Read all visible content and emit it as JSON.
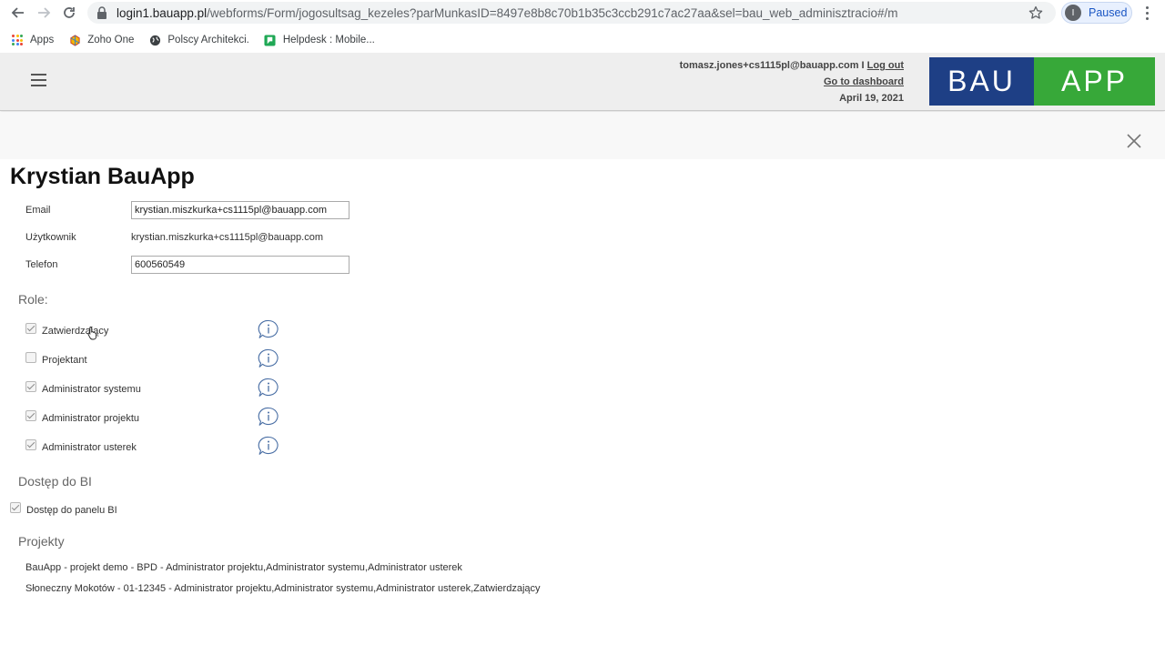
{
  "browser": {
    "url_host": "login1.bauapp.pl",
    "url_path": "/webforms/Form/jogosultsag_kezeles?parMunkasID=8497e8b8c70b1b35c3ccb291c7ac27aa&sel=bau_web_adminisztracio#/m",
    "profile_initial": "I",
    "profile_status": "Paused",
    "bookmarks": [
      "Apps",
      "Zoho One",
      "Polscy Architekci.",
      "Helpdesk : Mobile..."
    ]
  },
  "header": {
    "user_email": "tomasz.jones+cs1115pl@bauapp.com",
    "separator": "I",
    "logout_label": "Log out",
    "dashboard_label": "Go to dashboard",
    "date": "April 19, 2021",
    "logo_left": "BAU",
    "logo_right": "APP"
  },
  "form": {
    "title": "Krystian BauApp",
    "email_label": "Email",
    "email_value": "krystian.miszkurka+cs1115pl@bauapp.com",
    "user_label": "Użytkownik",
    "user_value": "krystian.miszkurka+cs1115pl@bauapp.com",
    "phone_label": "Telefon",
    "phone_value": "600560549"
  },
  "roles": {
    "heading": "Role:",
    "items": [
      {
        "label": "Zatwierdzający",
        "checked": true
      },
      {
        "label": "Projektant",
        "checked": false
      },
      {
        "label": "Administrator systemu",
        "checked": true
      },
      {
        "label": "Administrator projektu",
        "checked": true
      },
      {
        "label": "Administrator usterek",
        "checked": true
      }
    ]
  },
  "bi": {
    "heading": "Dostęp do BI",
    "label": "Dostęp do panelu BI",
    "checked": true
  },
  "projects": {
    "heading": "Projekty",
    "items": [
      "BauApp - projekt demo - BPD - Administrator projektu,Administrator systemu,Administrator usterek",
      "Słoneczny Mokotów - 01-12345 - Administrator projektu,Administrator systemu,Administrator usterek,Zatwierdzający"
    ]
  },
  "colors": {
    "logo_blue": "#1e3f85",
    "logo_green": "#37a839",
    "header_bg": "#eeeeee"
  }
}
